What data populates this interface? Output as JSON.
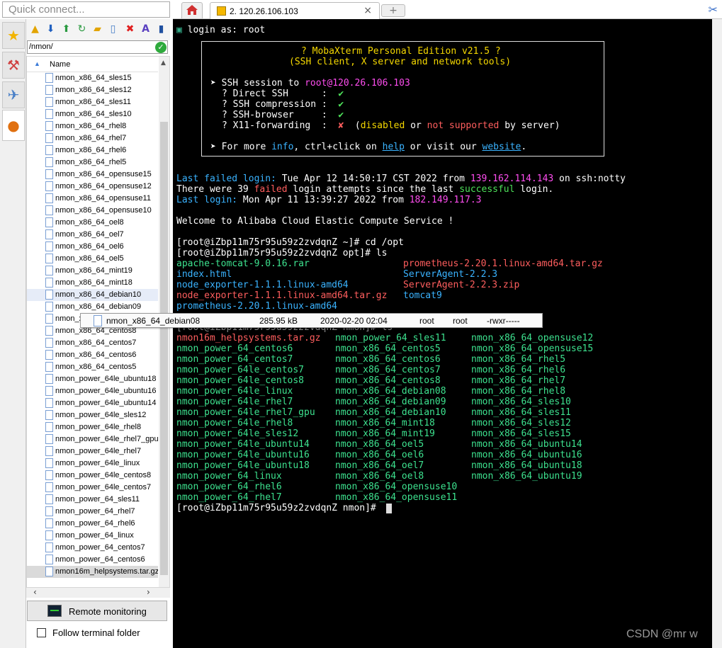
{
  "quick_connect": {
    "placeholder": "Quick connect..."
  },
  "tabs": {
    "session_label": "2. 120.26.106.103",
    "close_glyph": "×",
    "new_glyph": "+"
  },
  "sidebar_tabs": [
    "star-icon",
    "tools-icon",
    "paper-plane-icon",
    "globe-icon"
  ],
  "toolbar_icons": [
    "folder-up-icon",
    "download-icon",
    "upload-icon",
    "refresh-icon",
    "new-folder-icon",
    "new-file-icon",
    "delete-icon",
    "rename-icon",
    "terminal-icon"
  ],
  "path": {
    "value": "/nmon/",
    "ok_glyph": "✓"
  },
  "files": {
    "header": "Name",
    "items": [
      "nmon_x86_64_sles15",
      "nmon_x86_64_sles12",
      "nmon_x86_64_sles11",
      "nmon_x86_64_sles10",
      "nmon_x86_64_rhel8",
      "nmon_x86_64_rhel7",
      "nmon_x86_64_rhel6",
      "nmon_x86_64_rhel5",
      "nmon_x86_64_opensuse15",
      "nmon_x86_64_opensuse12",
      "nmon_x86_64_opensuse11",
      "nmon_x86_64_opensuse10",
      "nmon_x86_64_oel8",
      "nmon_x86_64_oel7",
      "nmon_x86_64_oel6",
      "nmon_x86_64_oel5",
      "nmon_x86_64_mint19",
      "nmon_x86_64_mint18",
      "nmon_x86_64_debian10",
      "nmon_x86_64_debian09",
      "nmon_x86_64_debian08",
      "nmon_x86_64_centos8",
      "nmon_x86_64_centos7",
      "nmon_x86_64_centos6",
      "nmon_x86_64_centos5",
      "nmon_power_64le_ubuntu18",
      "nmon_power_64le_ubuntu16",
      "nmon_power_64le_ubuntu14",
      "nmon_power_64le_sles12",
      "nmon_power_64le_rhel8",
      "nmon_power_64le_rhel7_gpu",
      "nmon_power_64le_rhel7",
      "nmon_power_64le_linux",
      "nmon_power_64le_centos8",
      "nmon_power_64le_centos7",
      "nmon_power_64_sles11",
      "nmon_power_64_rhel7",
      "nmon_power_64_rhel6",
      "nmon_power_64_linux",
      "nmon_power_64_centos7",
      "nmon_power_64_centos6",
      "nmon16m_helpsystems.tar.gz"
    ]
  },
  "tooltip": {
    "name": "nmon_x86_64_debian08",
    "size": "285.95 kB",
    "date": "2020-02-20 02:04",
    "owner": "root",
    "group": "root",
    "perms": "-rwxr-----"
  },
  "remote_monitoring": "Remote monitoring",
  "follow_folder": "Follow terminal folder",
  "terminal": {
    "login": "login as: root",
    "banner_title": "? MobaXterm Personal Edition v21.5 ?",
    "banner_sub": "(SSH client, X server and network tools)",
    "ssh_prefix": "➤ SSH session to ",
    "ssh_target": "root@120.26.106.103",
    "features": [
      {
        "label": "? Direct SSH      :  ",
        "mark": "✔"
      },
      {
        "label": "? SSH compression :  ",
        "mark": "✔"
      },
      {
        "label": "? SSH-browser     :  ",
        "mark": "✔"
      },
      {
        "label": "? X11-forwarding  :  ",
        "mark": "✘"
      }
    ],
    "x11_note_1": "  (",
    "x11_disabled": "disabled",
    "x11_or": " or ",
    "x11_not": "not supported",
    "x11_by": " by server)",
    "info_prefix": "➤ For more ",
    "info_word": "info",
    "info_mid": ", ctrl+click on ",
    "help_word": "help",
    "info_mid2": " or visit our ",
    "website_word": "website",
    "info_end": ".",
    "last_failed_label": "Last failed login:",
    "last_failed_text": " Tue Apr 12 14:50:17 CST 2022 from ",
    "last_failed_ip": "139.162.114.143",
    "last_failed_tail": " on ssh:notty",
    "there_were_1": "There were 39 ",
    "there_failed": "failed",
    "there_were_2": " login attempts since the last ",
    "there_success": "successful",
    "there_were_3": " login.",
    "last_login_label": "Last login:",
    "last_login_text": " Mon Apr 11 13:39:27 2022 from ",
    "last_login_ip": "182.149.117.3",
    "welcome": "Welcome to Alibaba Cloud Elastic Compute Service !",
    "cmd1": "[root@iZbp11m75r95u59z2zvdqnZ ~]# cd /opt",
    "cmd2": "[root@iZbp11m75r95u59z2zvdqnZ opt]# ls",
    "opt_left": [
      "apache-tomcat-9.0.16.rar",
      "index.html",
      "node_exporter-1.1.1.linux-amd64",
      "node_exporter-1.1.1.linux-amd64.tar.gz",
      "prometheus-2.20.1.linux-amd64"
    ],
    "opt_right": [
      "prometheus-2.20.1.linux-amd64.tar.gz",
      "ServerAgent-2.2.3",
      "ServerAgent-2.2.3.zip",
      "tomcat9"
    ],
    "cmd3_partial": "[root@iZbp11m75r95u59z2zvdqnZ nmon]# ls",
    "nmon_col1": [
      "nmon16m_helpsystems.tar.gz",
      "nmon_power_64_centos6",
      "nmon_power_64_centos7",
      "nmon_power_64le_centos7",
      "nmon_power_64le_centos8",
      "nmon_power_64le_linux",
      "nmon_power_64le_rhel7",
      "nmon_power_64le_rhel7_gpu",
      "nmon_power_64le_rhel8",
      "nmon_power_64le_sles12",
      "nmon_power_64le_ubuntu14",
      "nmon_power_64le_ubuntu16",
      "nmon_power_64le_ubuntu18",
      "nmon_power_64_linux",
      "nmon_power_64_rhel6",
      "nmon_power_64_rhel7"
    ],
    "nmon_col2": [
      "nmon_power_64_sles11",
      "nmon_x86_64_centos5",
      "nmon_x86_64_centos6",
      "nmon_x86_64_centos7",
      "nmon_x86_64_centos8",
      "nmon_x86_64_debian08",
      "nmon_x86_64_debian09",
      "nmon_x86_64_debian10",
      "nmon_x86_64_mint18",
      "nmon_x86_64_mint19",
      "nmon_x86_64_oel5",
      "nmon_x86_64_oel6",
      "nmon_x86_64_oel7",
      "nmon_x86_64_oel8",
      "nmon_x86_64_opensuse10",
      "nmon_x86_64_opensuse11"
    ],
    "nmon_col3": [
      "nmon_x86_64_opensuse12",
      "nmon_x86_64_opensuse15",
      "nmon_x86_64_rhel5",
      "nmon_x86_64_rhel6",
      "nmon_x86_64_rhel7",
      "nmon_x86_64_rhel8",
      "nmon_x86_64_sles10",
      "nmon_x86_64_sles11",
      "nmon_x86_64_sles12",
      "nmon_x86_64_sles15",
      "nmon_x86_64_ubuntu14",
      "nmon_x86_64_ubuntu16",
      "nmon_x86_64_ubuntu18",
      "nmon_x86_64_ubuntu19"
    ],
    "prompt_final": "[root@iZbp11m75r95u59z2zvdqnZ nmon]# "
  },
  "watermark": "CSDN @mr  w",
  "colors": {
    "term_bg": "#000000",
    "cyan": "#3ab3ff",
    "red": "#ff5e5e",
    "green": "#3de28f",
    "magenta": "#ff4df0",
    "yellow": "#f5d800"
  }
}
